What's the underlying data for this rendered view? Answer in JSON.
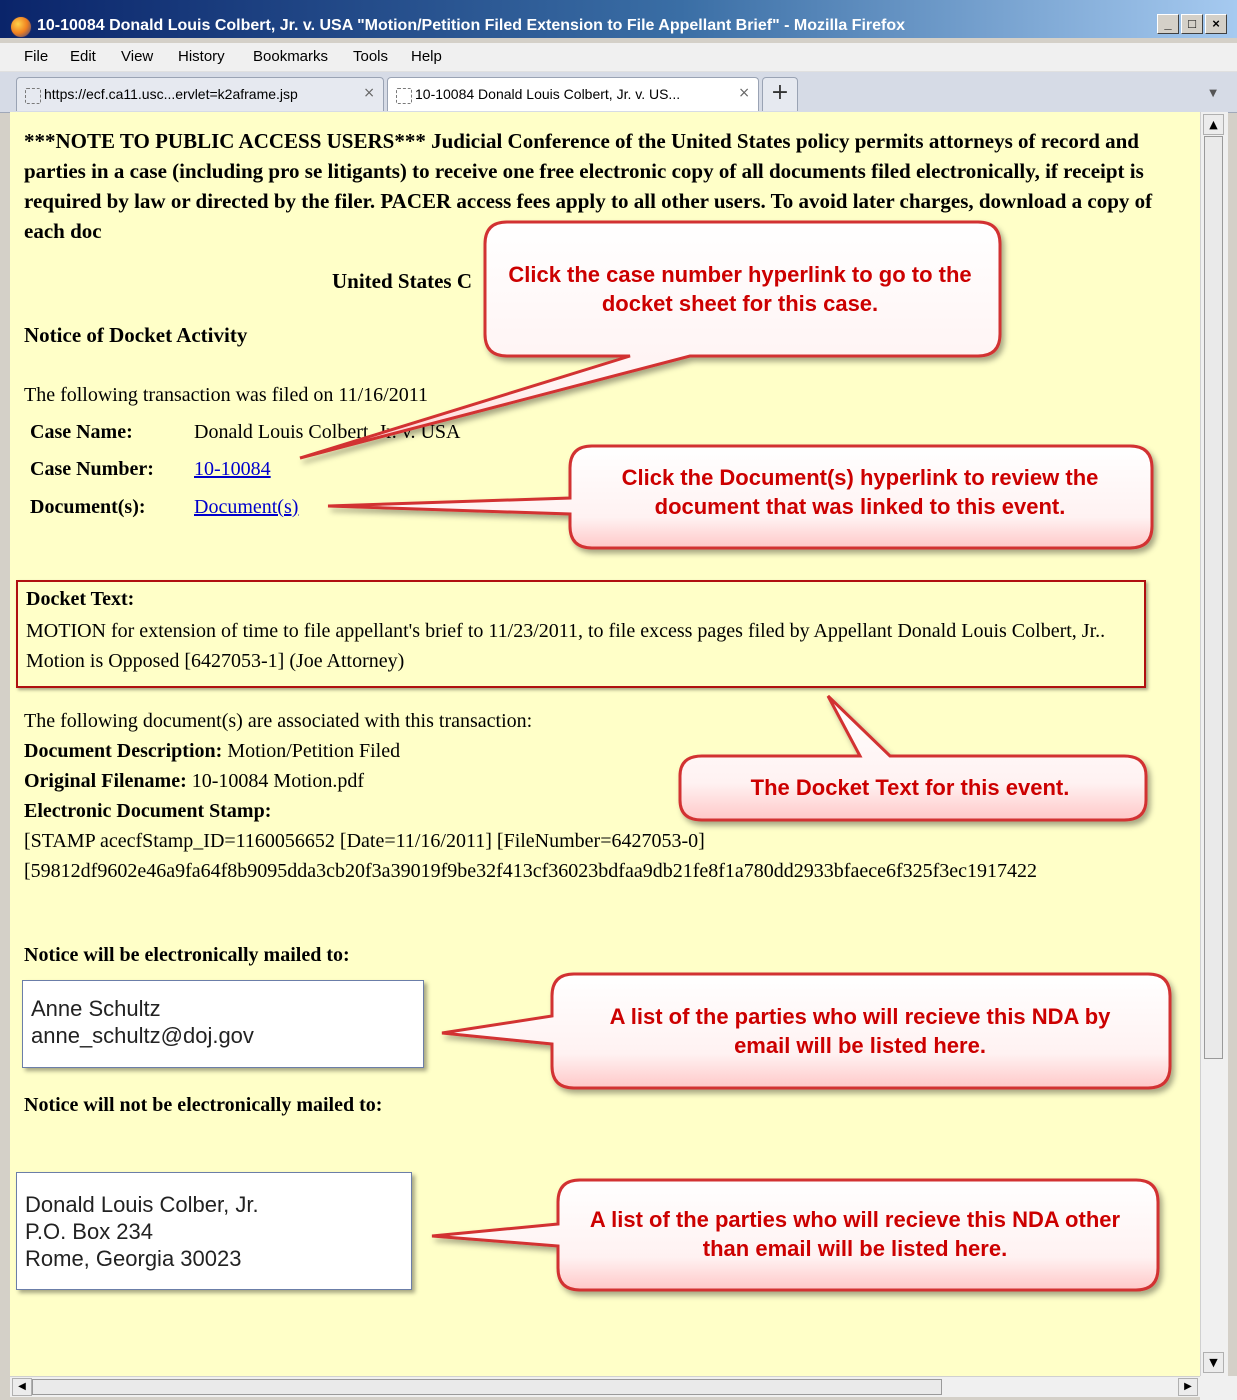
{
  "window": {
    "title": "10-10084 Donald Louis Colbert, Jr. v. USA \"Motion/Petition Filed Extension to File Appellant Brief\" - Mozilla Firefox",
    "controls": {
      "minimize": "_",
      "maximize": "□",
      "close": "×"
    }
  },
  "menu": [
    "File",
    "Edit",
    "View",
    "History",
    "Bookmarks",
    "Tools",
    "Help"
  ],
  "tabs": [
    {
      "label": "https://ecf.ca11.usc...ervlet=k2aframe.jsp",
      "close": "×",
      "active": false
    },
    {
      "label": "10-10084 Donald Louis Colbert, Jr. v. US...",
      "close": "×",
      "active": true
    }
  ],
  "new_tab": "+",
  "page": {
    "note": "***NOTE TO PUBLIC ACCESS USERS*** Judicial Conference of the United States policy permits attorneys of record and parties in a case (including pro se litigants) to receive one free electronic copy of all documents filed electronically, if receipt is required by law or directed by the filer. PACER access fees apply to all other users. To avoid later charges, download a copy of each doc",
    "court_heading": "United States C",
    "notice_heading": "Notice of Docket Activity",
    "filed_line": "The following transaction was filed on 11/16/2011",
    "case_name_label": "Case Name:",
    "case_name_value": "Donald Louis Colbert, Jr. v. USA",
    "case_number_label": "Case Number:",
    "case_number_link": "10-10084",
    "documents_label": "Document(s):",
    "documents_link": "Document(s)",
    "docket_text_heading": "Docket Text:",
    "docket_text": "MOTION for extension of time to file appellant's brief to 11/23/2011, to file excess pages filed by Appellant Donald Louis Colbert, Jr.. Motion is Opposed [6427053-1] (Joe Attorney)",
    "associated_line": "The following document(s) are associated with this transaction:",
    "doc_desc_label": "Document Description:",
    "doc_desc_value": "Motion/Petition Filed",
    "orig_filename_label": "Original Filename:",
    "orig_filename_value": "10-10084 Motion.pdf",
    "stamp_label": "Electronic Document Stamp:",
    "stamp_line1": "[STAMP acecfStamp_ID=1160056652 [Date=11/16/2011] [FileNumber=6427053-0]",
    "stamp_line2": "[59812df9602e46a9fa64f8b9095dda3cb20f3a39019f9be32f413cf36023bdfaa9db21fe8f1a780dd2933bfaece6f325f3ec1917422",
    "mailed_heading": "Notice will be electronically mailed to:",
    "mailed_recipients": [
      "Anne Schultz",
      "anne_schultz@doj.gov"
    ],
    "not_mailed_heading": "Notice will not be electronically mailed to:",
    "not_mailed_recipients": [
      "Donald Louis Colber, Jr.",
      "P.O. Box 234",
      "Rome, Georgia 30023"
    ]
  },
  "callouts": {
    "case_number": "Click the case number hyperlink to go to the docket sheet for this case.",
    "documents": "Click the Document(s) hyperlink to review the document that was linked to this event.",
    "docket_text": "The Docket Text for this event.",
    "email_parties": "A list of the parties who will recieve this NDA by email will be listed here.",
    "other_parties": "A list of the parties who will recieve this NDA other than email will be listed here."
  },
  "colors": {
    "page_background": "#ffffc8",
    "callout_text": "#cc0000",
    "callout_border": "#d23030",
    "docket_box_border": "#b01010",
    "link": "#0000cc"
  }
}
